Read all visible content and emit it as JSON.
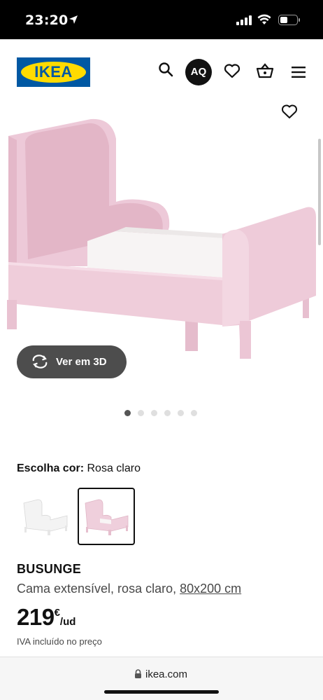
{
  "status_bar": {
    "time": "23:20"
  },
  "header": {
    "logo_text": "IKEA",
    "avatar_initials": "AQ"
  },
  "gallery": {
    "view_3d_label": "Ver em 3D",
    "image_count": 6,
    "active_index": 0
  },
  "product": {
    "color_label": "Escolha cor:",
    "color_value": "Rosa claro",
    "swatches": [
      "white",
      "pink"
    ],
    "selected_swatch": 1,
    "name": "BUSUNGE",
    "description": "Cama extensível, rosa claro,",
    "size": "80x200 cm",
    "price_integer": "219",
    "price_currency": "€",
    "price_unit": "/ud",
    "vat_note": "IVA incluído no preço"
  },
  "browser": {
    "url": "ikea.com"
  },
  "colors": {
    "bed_pink": "#efcfdc",
    "ikea_blue": "#0058a3",
    "ikea_yellow": "#ffdb00"
  }
}
